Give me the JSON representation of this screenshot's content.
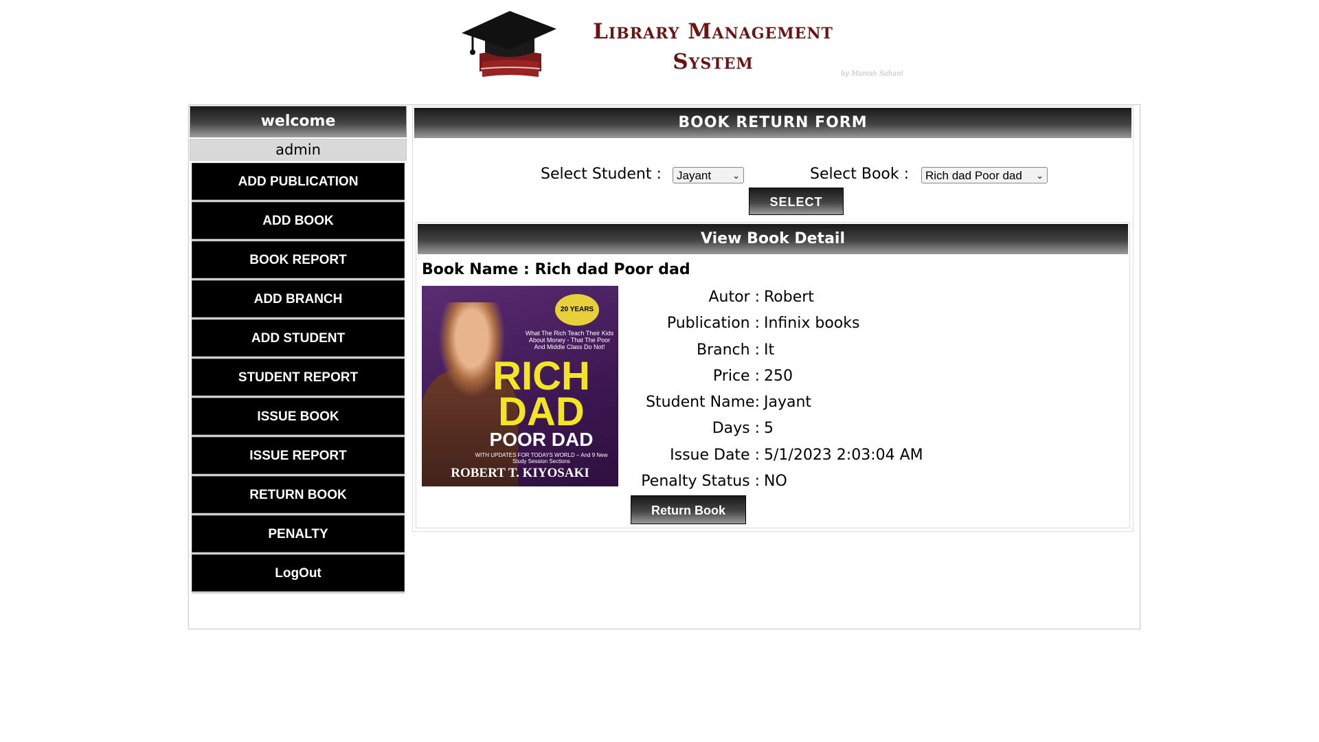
{
  "header": {
    "title_line1": "Library Management",
    "title_line2": "System",
    "byline": "by Manish Sahani",
    "logo_icon": "graduation-cap-books-icon"
  },
  "sidebar": {
    "welcome": "welcome",
    "user": "admin",
    "items": [
      {
        "label": "ADD PUBLICATION"
      },
      {
        "label": "ADD BOOK"
      },
      {
        "label": "BOOK REPORT"
      },
      {
        "label": "ADD BRANCH"
      },
      {
        "label": "ADD STUDENT"
      },
      {
        "label": "STUDENT REPORT"
      },
      {
        "label": "ISSUE BOOK"
      },
      {
        "label": "ISSUE REPORT"
      },
      {
        "label": "RETURN BOOK"
      },
      {
        "label": "PENALTY"
      },
      {
        "label": "LogOut"
      }
    ]
  },
  "form": {
    "title": "BOOK RETURN FORM",
    "student_label": "Select Student :",
    "student_value": "Jayant",
    "book_label": "Select Book :",
    "book_value": "Rich dad Poor dad",
    "select_button": "SELECT"
  },
  "detail": {
    "title": "View Book Detail",
    "book_name_label": "Book Name :",
    "book_name": "Rich dad Poor dad",
    "cover": {
      "badge": "20 YEARS",
      "tagline": "What The Rich Teach Their Kids About Money - That The Poor And Middle Class Do Not!",
      "word1": "RICH",
      "word2": "DAD",
      "word3": "POOR DAD",
      "update_note": "WITH UPDATES FOR TODAYS WORLD – And 9 New Study Session Sections",
      "author": "ROBERT T. KIYOSAKI"
    },
    "fields": [
      {
        "key": "Autor :",
        "value": "Robert"
      },
      {
        "key": "Publication :",
        "value": "Infinix books"
      },
      {
        "key": "Branch :",
        "value": "It"
      },
      {
        "key": "Price :",
        "value": "250"
      },
      {
        "key": "Student Name:",
        "value": "Jayant"
      },
      {
        "key": "Days :",
        "value": "5"
      },
      {
        "key": "Issue Date :",
        "value": "5/1/2023 2:03:04 AM"
      },
      {
        "key": "Penalty Status :",
        "value": "NO"
      }
    ],
    "return_button": "Return Book"
  },
  "colors": {
    "brand": "#6b1414",
    "menu_bg": "#000000",
    "header_gradient_top": "#1a1a1a",
    "header_gradient_bottom": "#9a9a9a"
  }
}
